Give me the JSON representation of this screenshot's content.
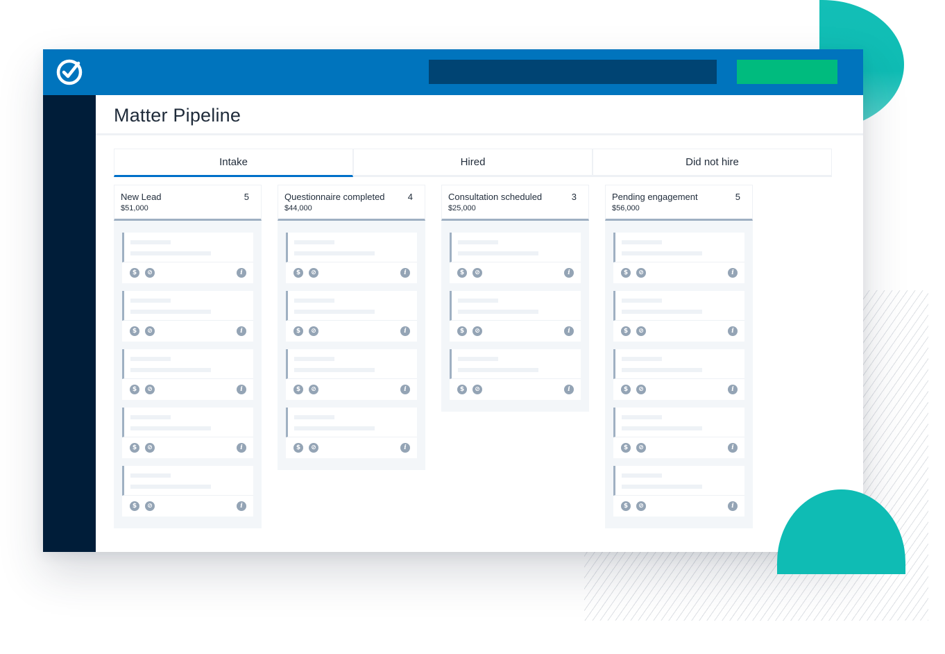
{
  "app": {
    "logo_icon": "checkmark-circle-icon",
    "colors": {
      "topbar": "#0074bd",
      "search": "#004473",
      "cta": "#00bb7e",
      "sidebar": "#001d39",
      "accent_tab": "#0070c9",
      "decor_teal": "#0fbcb4"
    }
  },
  "page": {
    "title": "Matter Pipeline"
  },
  "tabs": [
    {
      "label": "Intake",
      "active": true
    },
    {
      "label": "Hired",
      "active": false
    },
    {
      "label": "Did not hire",
      "active": false
    }
  ],
  "columns": [
    {
      "name": "New Lead",
      "count": "5",
      "total": "$51,000",
      "cards": 5
    },
    {
      "name": "Questionnaire completed",
      "count": "4",
      "total": "$44,000",
      "cards": 4
    },
    {
      "name": "Consultation scheduled",
      "count": "3",
      "total": "$25,000",
      "cards": 3
    },
    {
      "name": "Pending engagement",
      "count": "5",
      "total": "$56,000",
      "cards": 5
    }
  ],
  "card_icons": {
    "dollar": "$",
    "ban": "⊘",
    "info": "i"
  }
}
